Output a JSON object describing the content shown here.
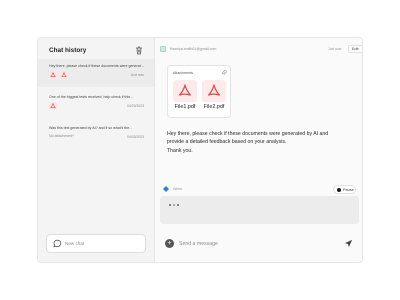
{
  "sidebar": {
    "title": "Chat history",
    "chats": [
      {
        "preview": "Hey there, please check if these documents were generated by AI...",
        "date": "Just now",
        "files": 2,
        "active": true
      },
      {
        "preview": "One of the biggest tests received, help check if this ...",
        "date": "04/03/2023",
        "files": 1,
        "active": false
      },
      {
        "preview": "Was this text generated by AI? and if so what's the...",
        "attachment": "No attachment*",
        "date": "04/03/2023",
        "files": 0,
        "active": false
      }
    ],
    "new_chat_label": "New chat"
  },
  "message": {
    "email": "Kseniya.smith01@gmail.com",
    "time": "Just now",
    "edit_label": "Edit",
    "attachments_title": "Attachments",
    "files": [
      "File1.pdf",
      "File2.pdf"
    ],
    "body_lines": [
      "Hey there, please check if these documents were generated by AI and",
      "provide a detailed feedback based on your analysis.",
      "Thank you."
    ]
  },
  "ai": {
    "name": "Writer",
    "pause_label": "Pause"
  },
  "composer": {
    "placeholder": "Send a message"
  },
  "colors": {
    "pdf": "#e04a4a",
    "pdf_bg": "#fdeaea",
    "ai_accent": "#2f7de1"
  }
}
